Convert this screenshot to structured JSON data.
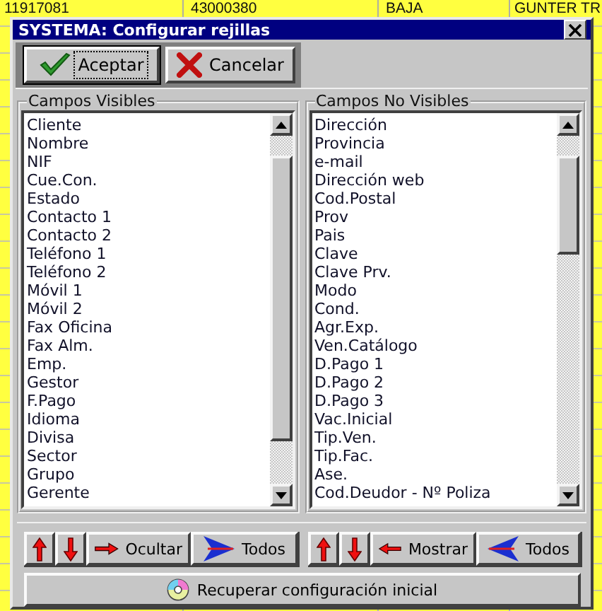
{
  "background_table": {
    "rows": [
      {
        "cells": [
          "11917081",
          "43000380",
          "BAJA",
          "GUNTER TR"
        ]
      }
    ]
  },
  "window": {
    "title": "SYSTEMA: Configurar rejillas"
  },
  "toolbar": [
    {
      "kind": "accept",
      "label": "Aceptar",
      "focused": true
    },
    {
      "kind": "cancel",
      "label": "Cancelar",
      "focused": false
    }
  ],
  "visible_fields": {
    "title": "Campos Visibles",
    "items": [
      "Cliente",
      "Nombre",
      "NIF",
      "Cue.Con.",
      "Estado",
      "Contacto 1",
      "Contacto 2",
      "Teléfono 1",
      "Teléfono 2",
      "Móvil 1",
      "Móvil 2",
      "Fax Oficina",
      "Fax Alm.",
      "Emp.",
      "Gestor",
      "F.Pago",
      "Idioma",
      "Divisa",
      "Sector",
      "Grupo",
      "Gerente"
    ]
  },
  "hidden_fields": {
    "title": "Campos No Visibles",
    "items": [
      "Dirección",
      "Provincia",
      "e-mail",
      "Dirección web",
      "Cod.Postal",
      "Prov",
      "Pais",
      "Clave",
      "Clave Prv.",
      "Modo",
      "Cond.",
      "Agr.Exp.",
      "Ven.Catálogo",
      "D.Pago 1",
      "D.Pago 2",
      "D.Pago 3",
      "Vac.Inicial",
      "Tip.Ven.",
      "Tip.Fac.",
      "Ase.",
      "Cod.Deudor - Nº Poliza"
    ]
  },
  "visible_actions": [
    {
      "kind": "up"
    },
    {
      "kind": "down"
    },
    {
      "kind": "hide",
      "label": "Ocultar"
    },
    {
      "kind": "all-right",
      "label": "Todos"
    }
  ],
  "hidden_actions": [
    {
      "kind": "up"
    },
    {
      "kind": "down"
    },
    {
      "kind": "show",
      "label": "Mostrar"
    },
    {
      "kind": "all-left",
      "label": "Todos"
    }
  ],
  "reset_button": {
    "label": "Recuperar configuración inicial"
  }
}
